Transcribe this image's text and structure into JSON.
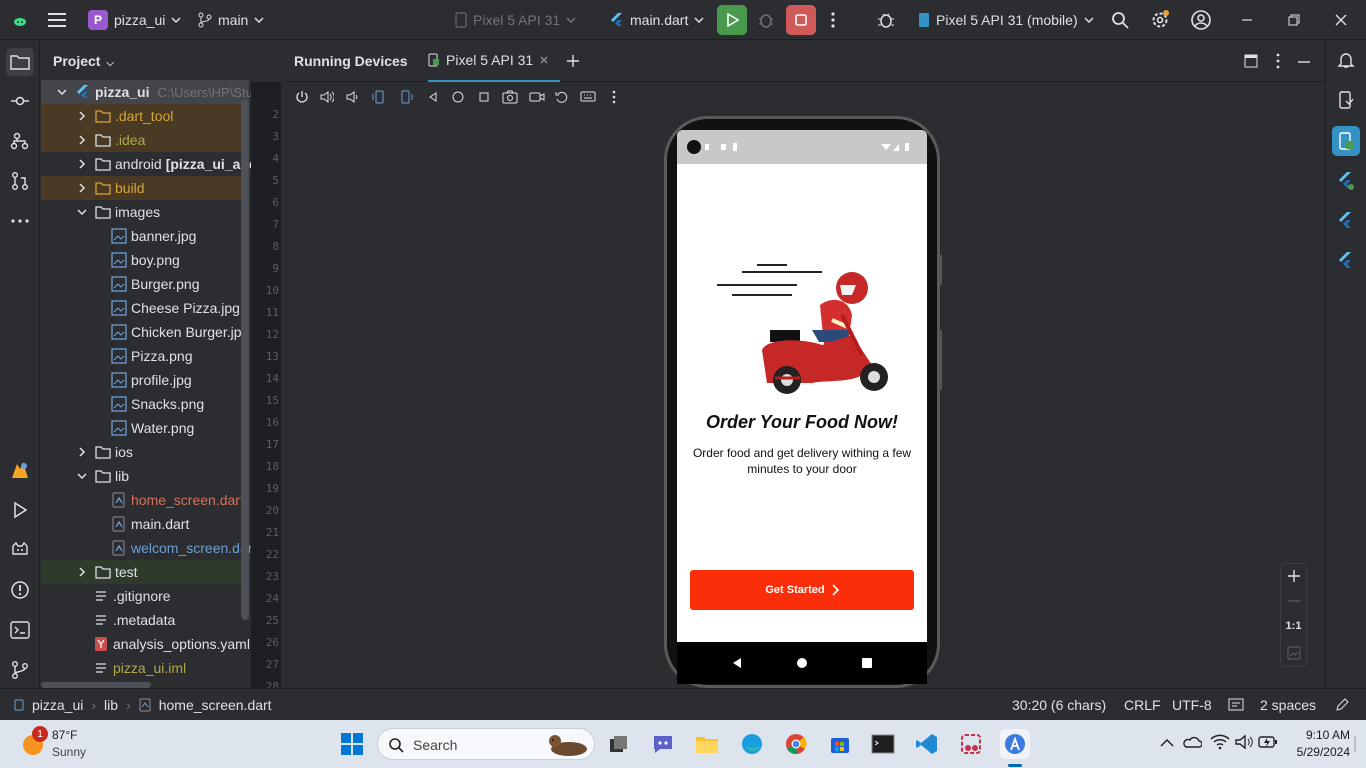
{
  "titlebar": {
    "project_badge": "P",
    "project_name": "pizza_ui",
    "branch": "main",
    "device_config": "Pixel 5 API 31",
    "run_config": "main.dart",
    "target_device": "Pixel 5 API 31 (mobile)"
  },
  "project_panel": {
    "title": "Project",
    "root_name": "pizza_ui",
    "root_path": "C:\\Users\\HP\\Stu...",
    "items": [
      {
        "label": ".dart_tool",
        "kind": "folder",
        "color": "orange"
      },
      {
        "label": ".idea",
        "kind": "folder",
        "color": "olive"
      },
      {
        "label": "android",
        "suffix": "[pizza_ui_andr...",
        "kind": "folder",
        "color": "gray"
      },
      {
        "label": "build",
        "kind": "folder",
        "color": "orange"
      },
      {
        "label": "images",
        "kind": "folder",
        "color": "gray"
      },
      {
        "label": "banner.jpg",
        "kind": "image",
        "color": "gray"
      },
      {
        "label": "boy.png",
        "kind": "image",
        "color": "gray"
      },
      {
        "label": "Burger.png",
        "kind": "image",
        "color": "gray"
      },
      {
        "label": "Cheese Pizza.jpg",
        "kind": "image",
        "color": "gray"
      },
      {
        "label": "Chicken Burger.jpg",
        "kind": "image",
        "color": "gray"
      },
      {
        "label": "Pizza.png",
        "kind": "image",
        "color": "gray"
      },
      {
        "label": "profile.jpg",
        "kind": "image",
        "color": "gray"
      },
      {
        "label": "Snacks.png",
        "kind": "image",
        "color": "gray"
      },
      {
        "label": "Water.png",
        "kind": "image",
        "color": "gray"
      },
      {
        "label": "ios",
        "kind": "folder",
        "color": "gray"
      },
      {
        "label": "lib",
        "kind": "folder",
        "color": "gray"
      },
      {
        "label": "home_screen.dart",
        "kind": "dart",
        "color": "red"
      },
      {
        "label": "main.dart",
        "kind": "dart",
        "color": "gray"
      },
      {
        "label": "welcom_screen.dart",
        "kind": "dart",
        "color": "blue"
      },
      {
        "label": "test",
        "kind": "folder",
        "color": "gray"
      },
      {
        "label": ".gitignore",
        "kind": "file",
        "color": "gray"
      },
      {
        "label": ".metadata",
        "kind": "file",
        "color": "gray"
      },
      {
        "label": "analysis_options.yaml",
        "kind": "yaml",
        "color": "gray"
      },
      {
        "label": "pizza_ui.iml",
        "kind": "file",
        "color": "olive"
      }
    ]
  },
  "gutter": {
    "line_numbers": [
      "2",
      "3",
      "4",
      "5",
      "6",
      "7",
      "8",
      "9",
      "10",
      "11",
      "12",
      "13",
      "14",
      "15",
      "16",
      "17",
      "18",
      "19",
      "20",
      "21",
      "22",
      "23",
      "24",
      "25",
      "26",
      "27",
      "28"
    ]
  },
  "running_devices": {
    "panel_title": "Running Devices",
    "device_tab": "Pixel 5 API 31",
    "zoom_reset": "1:1"
  },
  "app_screen": {
    "headline": "Order Your Food Now!",
    "subtitle": "Order food and get delivery withing a few minutes to your door",
    "cta_label": "Get Started",
    "cta_color": "#fc2e0a"
  },
  "statusline": {
    "breadcrumb": [
      "pizza_ui",
      "lib",
      "home_screen.dart"
    ],
    "cursor": "30:20 (6 chars)",
    "line_ending": "CRLF",
    "encoding": "UTF-8",
    "indent": "2 spaces"
  },
  "taskbar": {
    "weather_temp": "87°F",
    "weather_desc": "Sunny",
    "weather_badge": "1",
    "search_placeholder": "Search",
    "time": "9:10 AM",
    "date": "5/29/2024"
  }
}
